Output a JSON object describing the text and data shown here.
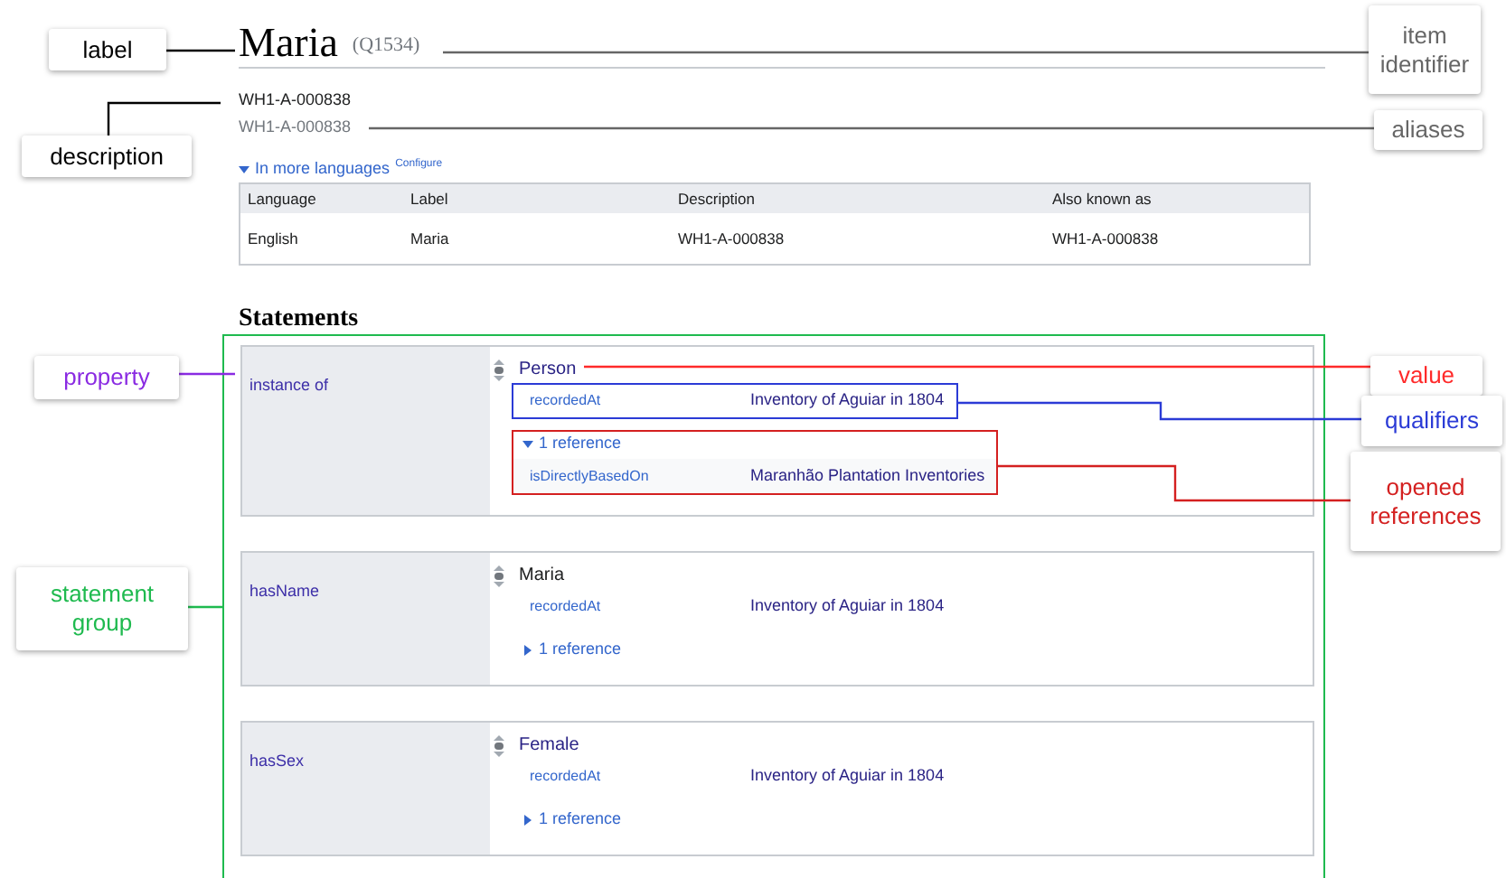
{
  "item": {
    "label": "Maria",
    "identifier": "(Q1534)",
    "description": "WH1-A-000838",
    "aliases": "WH1-A-000838"
  },
  "languages": {
    "toggle": "In more languages",
    "expanded": true,
    "configure": "Configure",
    "columns": [
      "Language",
      "Label",
      "Description",
      "Also known as"
    ],
    "rows": [
      [
        "English",
        "Maria",
        "WH1-A-000838",
        "WH1-A-000838"
      ]
    ]
  },
  "statements": {
    "heading": "Statements",
    "groups": [
      {
        "property": "instance of",
        "value": "Person",
        "kind": "item",
        "qualifiers": [
          {
            "property": "recordedAt",
            "value": "Inventory of Aguiar in 1804",
            "highlighted": true
          }
        ],
        "references": {
          "label": "1 reference",
          "expanded": true,
          "highlighted": true,
          "rows": [
            {
              "property": "isDirectlyBasedOn",
              "value": "Maranhão Plantation Inventories"
            }
          ]
        }
      },
      {
        "property": "hasName",
        "value": "Maria",
        "kind": "string",
        "qualifiers": [
          {
            "property": "recordedAt",
            "value": "Inventory of Aguiar in 1804",
            "highlighted": false
          }
        ],
        "references": {
          "label": "1 reference",
          "expanded": false,
          "highlighted": false
        }
      },
      {
        "property": "hasSex",
        "value": "Female",
        "kind": "item",
        "qualifiers": [
          {
            "property": "recordedAt",
            "value": "Inventory of Aguiar in 1804",
            "highlighted": false
          }
        ],
        "references": {
          "label": "1 reference",
          "expanded": false,
          "highlighted": false
        }
      }
    ]
  },
  "annotations": [
    {
      "kind": "label",
      "text": "label",
      "color": "#000000"
    },
    {
      "kind": "description",
      "text": "description",
      "color": "#000000"
    },
    {
      "kind": "property",
      "text": "property",
      "color": "#8a2be2"
    },
    {
      "kind": "group",
      "text": "statement group",
      "color": "#1fba4f"
    },
    {
      "kind": "identifier",
      "text": "item identifier",
      "color": "#666666"
    },
    {
      "kind": "aliases",
      "text": "aliases",
      "color": "#666666"
    },
    {
      "kind": "value",
      "text": "value",
      "color": "#ff2a2a"
    },
    {
      "kind": "qualifiers",
      "text": "qualifiers",
      "color": "#2b3bd6"
    },
    {
      "kind": "references",
      "text": "opened references",
      "color": "#d42020"
    }
  ]
}
